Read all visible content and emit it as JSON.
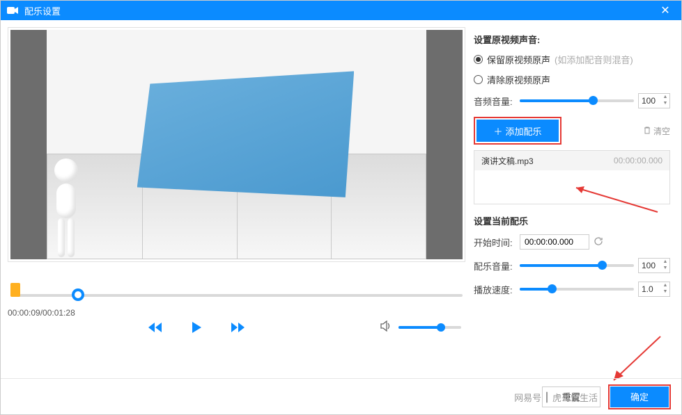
{
  "titlebar": {
    "title": "配乐设置",
    "close": "✕"
  },
  "seek": {
    "time": "00:00:09/00:01:28",
    "head_pct": 14
  },
  "volume_player": {
    "pct": 68
  },
  "right": {
    "section_orig": "设置原视频声音:",
    "radio_keep": "保留原视频原声",
    "radio_keep_hint": "(如添加配音则混音)",
    "radio_clear": "清除原视频原声",
    "audio_vol_label": "音频音量:",
    "audio_vol_value": "100",
    "audio_vol_pct": 64,
    "add_btn": "添加配乐",
    "clear_link": "清空",
    "track_name": "演讲文稿.mp3",
    "track_time": "00:00:00.000",
    "section_current": "设置当前配乐",
    "start_label": "开始时间:",
    "start_value": "00:00:00.000",
    "mix_vol_label": "配乐音量:",
    "mix_vol_value": "100",
    "mix_vol_pct": 72,
    "speed_label": "播放速度:",
    "speed_value": "1.0",
    "speed_pct": 28
  },
  "footer": {
    "reset": "重置",
    "ok": "确定",
    "watermark_a": "网易号",
    "watermark_b": "虎哥慢生活"
  }
}
